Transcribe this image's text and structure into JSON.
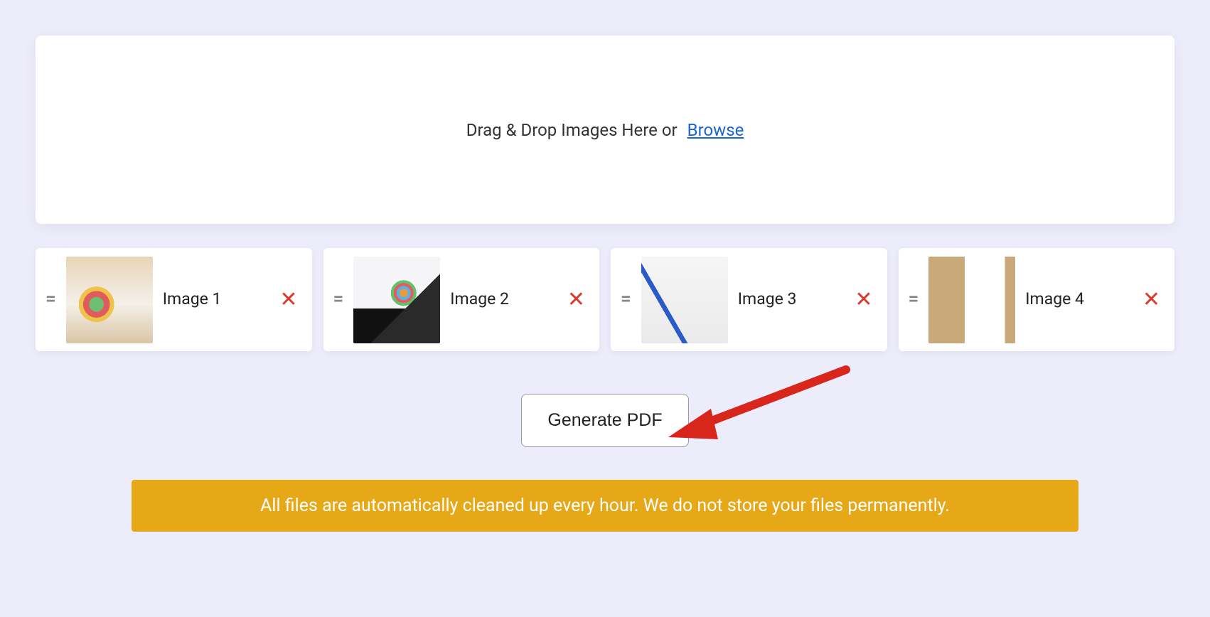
{
  "dropzone": {
    "text": "Drag & Drop Images Here or",
    "browse": "Browse"
  },
  "images": [
    {
      "label": "Image 1"
    },
    {
      "label": "Image 2"
    },
    {
      "label": "Image 3"
    },
    {
      "label": "Image 4"
    }
  ],
  "actions": {
    "generate": "Generate PDF"
  },
  "notice": "All files are automatically cleaned up every hour. We do not store your files permanently."
}
